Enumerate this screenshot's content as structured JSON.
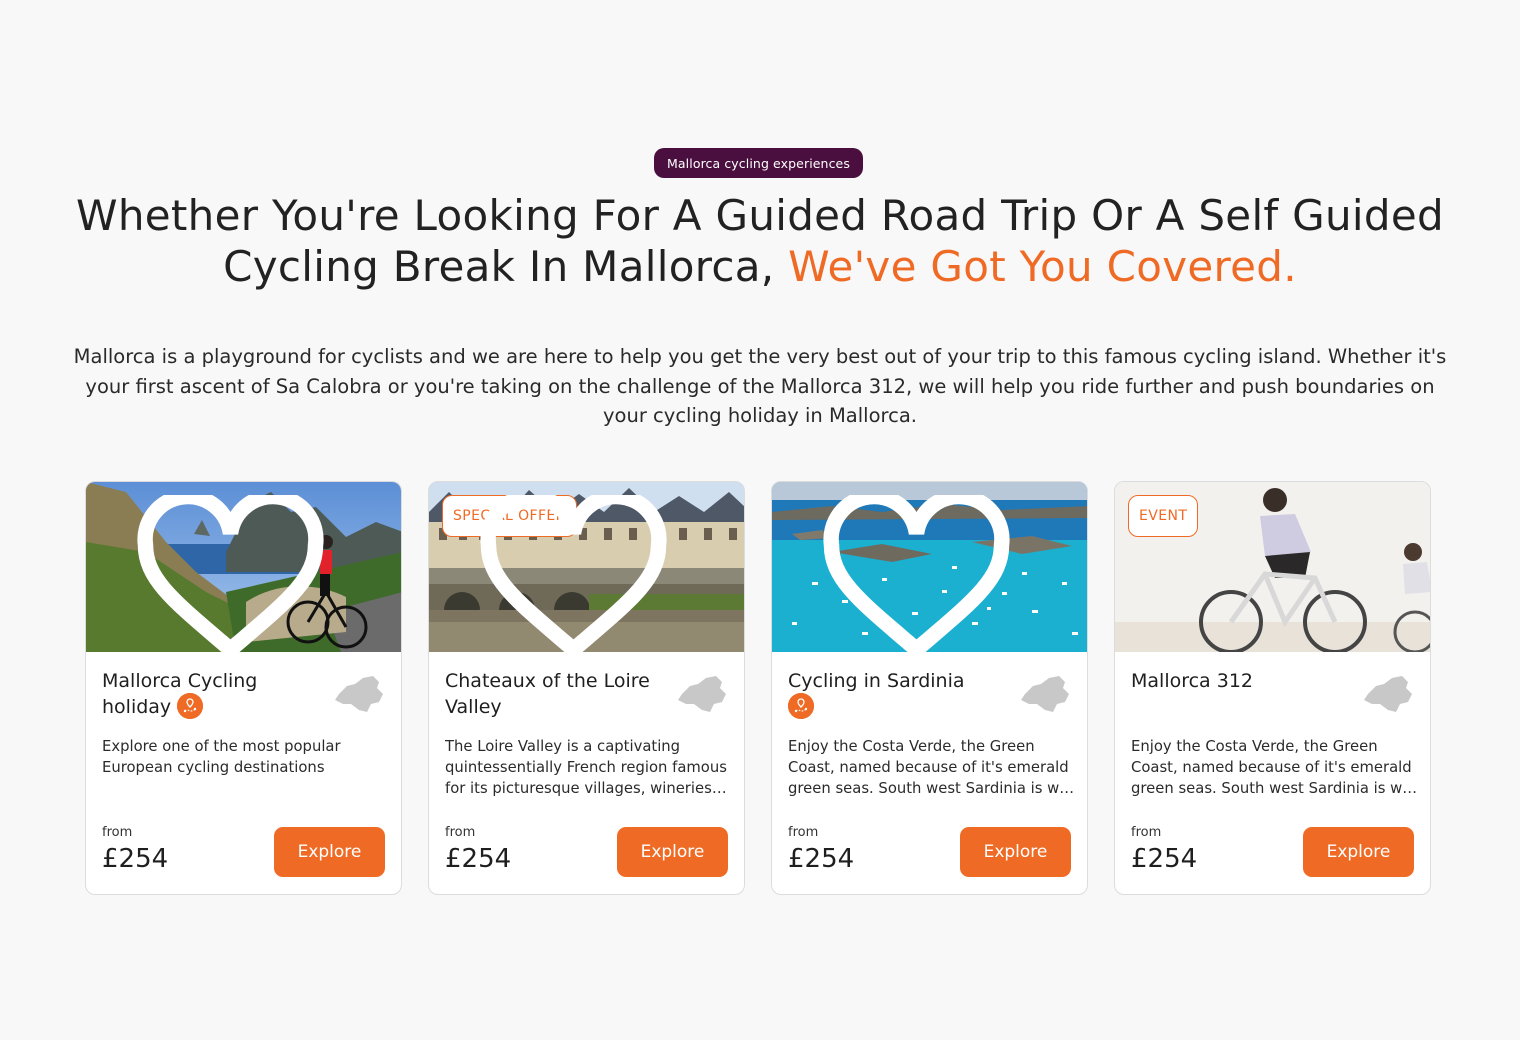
{
  "section": {
    "tag": "Mallorca cycling experiences",
    "headline_line1": "Whether You're Looking For A Guided Road Trip Or A Self Guided",
    "headline_line2_plain": "Cycling Break In Mallorca,",
    "headline_line2_accent": "We've Got You Covered.",
    "intro": "Mallorca is a playground for cyclists and we are here to help you get the very best out of your trip to this famous cycling island. Whether it's your first ascent of Sa Calobra or you're taking on the challenge of the Mallorca 312, we will help you ride further and push boundaries on your cycling holiday in Mallorca."
  },
  "colors": {
    "accent": "#ef6b25",
    "tag_bg": "#4a0f3f",
    "page_bg": "#f8f8f8",
    "map_icon": "#c8c8c8"
  },
  "cards": [
    {
      "title": "Mallorca Cycling holiday",
      "badge": "",
      "has_pin_icon": true,
      "description": "Explore one of the most popular European cycling destinations",
      "from_label": "from",
      "price": "£254",
      "button": "Explore",
      "image": "cyclist-coast-photo"
    },
    {
      "title": "Chateaux of the Loire Valley",
      "badge": "SPECIAL OFFER",
      "has_pin_icon": false,
      "description": "The Loire Valley is a captivating quintessentially French region famous for its picturesque villages, wineries and chateaux",
      "from_label": "from",
      "price": "£254",
      "button": "Explore",
      "image": "loire-chateau-photo"
    },
    {
      "title": "Cycling in Sardinia",
      "badge": "",
      "has_pin_icon": true,
      "description": "Enjoy the Costa Verde, the Green Coast, named because of it's emerald green seas. South west Sardinia is wild and unspoilt",
      "from_label": "from",
      "price": "£254",
      "button": "Explore",
      "image": "sardinia-bay-photo"
    },
    {
      "title": "Mallorca 312",
      "badge": "EVENT",
      "has_pin_icon": false,
      "description": "Enjoy the Costa Verde, the Green Coast, named because of it's emerald green seas. South west Sardinia is wild and unspoilt",
      "from_label": "from",
      "price": "£254",
      "button": "Explore",
      "image": "road-cyclists-photo"
    }
  ]
}
